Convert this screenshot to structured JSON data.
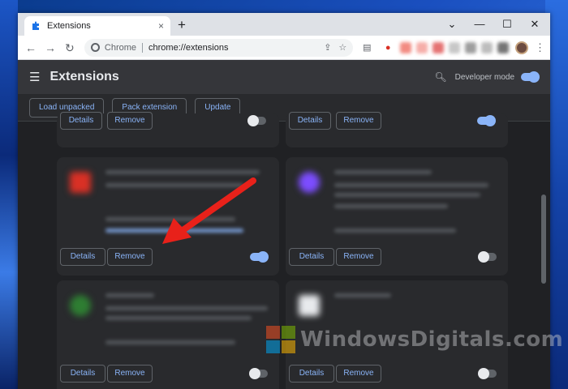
{
  "browser": {
    "tab_title": "Extensions",
    "tab_close": "×",
    "new_tab": "+",
    "window_controls": [
      "⌄",
      "—",
      "☐",
      "✕"
    ],
    "site_label": "Chrome",
    "url": "chrome://extensions"
  },
  "page": {
    "title": "Extensions",
    "developer_mode_label": "Developer mode",
    "developer_mode_on": true
  },
  "actions": [
    "Load unpacked",
    "Pack extension",
    "Update"
  ],
  "cards": [
    {
      "details": "Details",
      "remove": "Remove",
      "enabled": false
    },
    {
      "details": "Details",
      "remove": "Remove",
      "enabled": true
    },
    {
      "details": "Details",
      "remove": "Remove",
      "enabled": true,
      "icon_color": "#d93025"
    },
    {
      "details": "Details",
      "remove": "Remove",
      "enabled": false,
      "icon_color": "#7c4dff"
    },
    {
      "details": "Details",
      "remove": "Remove",
      "enabled": false,
      "icon_color": "#2e7d32"
    },
    {
      "details": "Details",
      "remove": "Remove",
      "enabled": false,
      "icon_color": "#e8eaed"
    }
  ],
  "watermark": "WindowsDigitals.com",
  "colors": {
    "accent": "#8ab4f8",
    "arrow": "#e8211a"
  }
}
